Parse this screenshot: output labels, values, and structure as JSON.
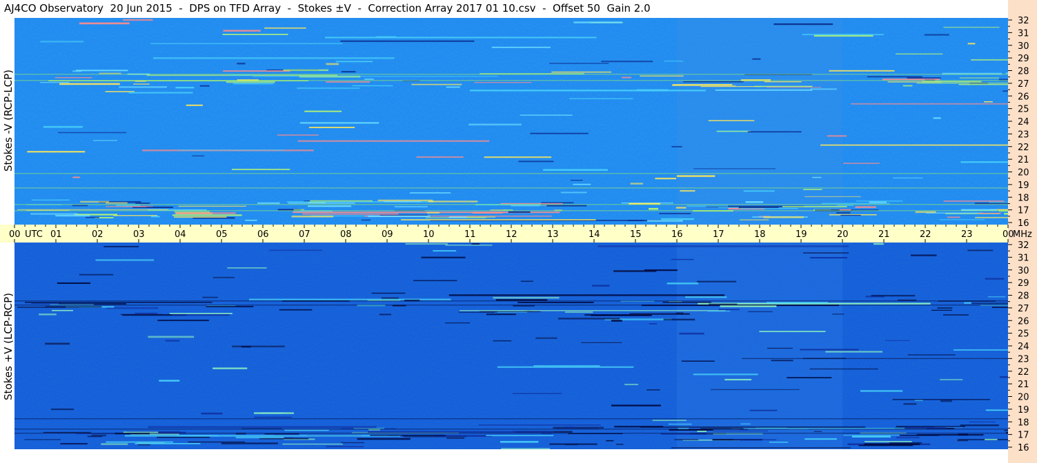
{
  "header": {
    "title": "AJ4CO Observatory  20 Jun 2015  -  DPS on TFD Array  -  Stokes ±V  -  Correction Array 2017 01 10.csv  -  Offset 50  Gain 2.0"
  },
  "colors": {
    "time_axis_band": "#ffffc8",
    "freq_axis_strip": "#fce0c8",
    "panel_top_base": "#1e8cf0",
    "panel_bottom_base": "#1460dc"
  },
  "chart_data": [
    {
      "type": "heatmap",
      "panel": "top",
      "ylabel": "Stokes -V (RCP-LCP)",
      "y_unit": "MHz",
      "ylim": [
        16,
        32
      ],
      "y_ticks": [
        "16",
        "17",
        "18",
        "19",
        "20",
        "21",
        "22",
        "23",
        "24",
        "25",
        "26",
        "27",
        "28",
        "29",
        "30",
        "31",
        "32"
      ],
      "xlim_utc_hours": [
        0,
        24
      ]
    },
    {
      "type": "heatmap",
      "panel": "bottom",
      "ylabel": "Stokes +V (LCP-RCP)",
      "y_unit": "MHz",
      "ylim": [
        16,
        32
      ],
      "y_ticks": [
        "16",
        "17",
        "18",
        "19",
        "20",
        "21",
        "22",
        "23",
        "24",
        "25",
        "26",
        "27",
        "28",
        "29",
        "30",
        "31",
        "32"
      ],
      "xlim_utc_hours": [
        0,
        24
      ]
    }
  ],
  "time_axis": {
    "labels": [
      "00",
      "01",
      "02",
      "03",
      "04",
      "05",
      "06",
      "07",
      "08",
      "09",
      "10",
      "11",
      "12",
      "13",
      "14",
      "15",
      "16",
      "17",
      "18",
      "19",
      "20",
      "21",
      "22",
      "23",
      "00"
    ],
    "utc_label": "UTC",
    "unit_label": "MHz"
  }
}
